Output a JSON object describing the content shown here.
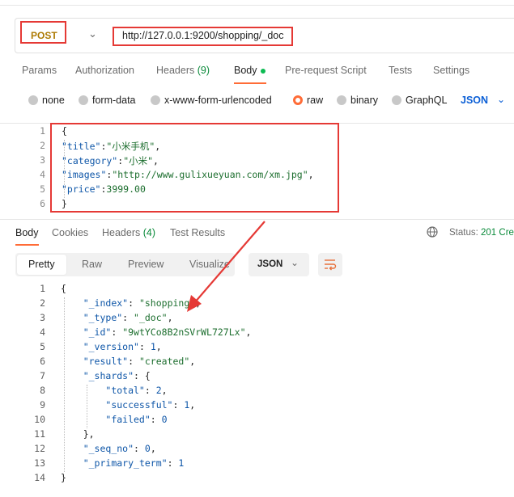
{
  "request": {
    "method": "POST",
    "url": "http://127.0.0.1:9200/shopping/_doc"
  },
  "request_tabs": [
    {
      "label": "Params",
      "count": ""
    },
    {
      "label": "Authorization",
      "count": ""
    },
    {
      "label": "Headers",
      "count": "(9)"
    },
    {
      "label": "Body",
      "count": ""
    },
    {
      "label": "Pre-request Script",
      "count": ""
    },
    {
      "label": "Tests",
      "count": ""
    },
    {
      "label": "Settings",
      "count": ""
    }
  ],
  "active_request_tab": "Body",
  "body_types": [
    "none",
    "form-data",
    "x-www-form-urlencoded",
    "raw",
    "binary",
    "GraphQL"
  ],
  "selected_body_type": "raw",
  "body_language": "JSON",
  "request_body": {
    "line_numbers": [
      "1",
      "2",
      "3",
      "4",
      "5",
      "6"
    ],
    "lines": [
      [
        {
          "t": "{",
          "c": "p"
        }
      ],
      [
        {
          "t": "\"title\"",
          "c": "k"
        },
        {
          "t": ":",
          "c": "p"
        },
        {
          "t": "\"小米手机\"",
          "c": "s"
        },
        {
          "t": ",",
          "c": "p"
        }
      ],
      [
        {
          "t": "\"category\"",
          "c": "k"
        },
        {
          "t": ":",
          "c": "p"
        },
        {
          "t": "\"小米\"",
          "c": "s"
        },
        {
          "t": ",",
          "c": "p"
        }
      ],
      [
        {
          "t": "\"images\"",
          "c": "k"
        },
        {
          "t": ":",
          "c": "p"
        },
        {
          "t": "\"http://www.gulixueyuan.com/xm.jpg\"",
          "c": "s"
        },
        {
          "t": ",",
          "c": "p"
        }
      ],
      [
        {
          "t": "\"price\"",
          "c": "k"
        },
        {
          "t": ":",
          "c": "p"
        },
        {
          "t": "3999.00",
          "c": "n"
        }
      ],
      [
        {
          "t": "}",
          "c": "p"
        }
      ]
    ]
  },
  "response_tabs": [
    {
      "label": "Body",
      "count": ""
    },
    {
      "label": "Cookies",
      "count": ""
    },
    {
      "label": "Headers",
      "count": "(4)"
    },
    {
      "label": "Test Results",
      "count": ""
    }
  ],
  "status": {
    "label": "Status:",
    "value": "201 Cre"
  },
  "view_modes": [
    "Pretty",
    "Raw",
    "Preview",
    "Visualize"
  ],
  "response_format": "JSON",
  "response_body": {
    "line_numbers": [
      "1",
      "2",
      "3",
      "4",
      "5",
      "6",
      "7",
      "8",
      "9",
      "10",
      "11",
      "12",
      "13",
      "14"
    ],
    "lines": [
      [
        {
          "t": "{",
          "c": "p"
        }
      ],
      [
        {
          "t": "    ",
          "c": "p"
        },
        {
          "t": "\"_index\"",
          "c": "rk"
        },
        {
          "t": ": ",
          "c": "p"
        },
        {
          "t": "\"shopping\"",
          "c": "rs"
        },
        {
          "t": ",",
          "c": "p"
        }
      ],
      [
        {
          "t": "    ",
          "c": "p"
        },
        {
          "t": "\"_type\"",
          "c": "rk"
        },
        {
          "t": ": ",
          "c": "p"
        },
        {
          "t": "\"_doc\"",
          "c": "rs"
        },
        {
          "t": ",",
          "c": "p"
        }
      ],
      [
        {
          "t": "    ",
          "c": "p"
        },
        {
          "t": "\"_id\"",
          "c": "rk"
        },
        {
          "t": ": ",
          "c": "p"
        },
        {
          "t": "\"9wtYCo8B2nSVrWL727Lx\"",
          "c": "rs"
        },
        {
          "t": ",",
          "c": "p"
        }
      ],
      [
        {
          "t": "    ",
          "c": "p"
        },
        {
          "t": "\"_version\"",
          "c": "rk"
        },
        {
          "t": ": ",
          "c": "p"
        },
        {
          "t": "1",
          "c": "rn"
        },
        {
          "t": ",",
          "c": "p"
        }
      ],
      [
        {
          "t": "    ",
          "c": "p"
        },
        {
          "t": "\"result\"",
          "c": "rk"
        },
        {
          "t": ": ",
          "c": "p"
        },
        {
          "t": "\"created\"",
          "c": "rs"
        },
        {
          "t": ",",
          "c": "p"
        }
      ],
      [
        {
          "t": "    ",
          "c": "p"
        },
        {
          "t": "\"_shards\"",
          "c": "rk"
        },
        {
          "t": ": {",
          "c": "p"
        }
      ],
      [
        {
          "t": "        ",
          "c": "p"
        },
        {
          "t": "\"total\"",
          "c": "rk"
        },
        {
          "t": ": ",
          "c": "p"
        },
        {
          "t": "2",
          "c": "rn"
        },
        {
          "t": ",",
          "c": "p"
        }
      ],
      [
        {
          "t": "        ",
          "c": "p"
        },
        {
          "t": "\"successful\"",
          "c": "rk"
        },
        {
          "t": ": ",
          "c": "p"
        },
        {
          "t": "1",
          "c": "rn"
        },
        {
          "t": ",",
          "c": "p"
        }
      ],
      [
        {
          "t": "        ",
          "c": "p"
        },
        {
          "t": "\"failed\"",
          "c": "rk"
        },
        {
          "t": ": ",
          "c": "p"
        },
        {
          "t": "0",
          "c": "rn"
        }
      ],
      [
        {
          "t": "    },",
          "c": "p"
        }
      ],
      [
        {
          "t": "    ",
          "c": "p"
        },
        {
          "t": "\"_seq_no\"",
          "c": "rk"
        },
        {
          "t": ": ",
          "c": "p"
        },
        {
          "t": "0",
          "c": "rn"
        },
        {
          "t": ",",
          "c": "p"
        }
      ],
      [
        {
          "t": "    ",
          "c": "p"
        },
        {
          "t": "\"_primary_term\"",
          "c": "rk"
        },
        {
          "t": ": ",
          "c": "p"
        },
        {
          "t": "1",
          "c": "rn"
        }
      ],
      [
        {
          "t": "}",
          "c": "p"
        }
      ]
    ]
  },
  "colors": {
    "accent": "#ff6c37",
    "highlight_box": "#e53935",
    "method": "#ad7a03",
    "link_blue": "#0b5fd6",
    "success": "#0a8a3a"
  }
}
